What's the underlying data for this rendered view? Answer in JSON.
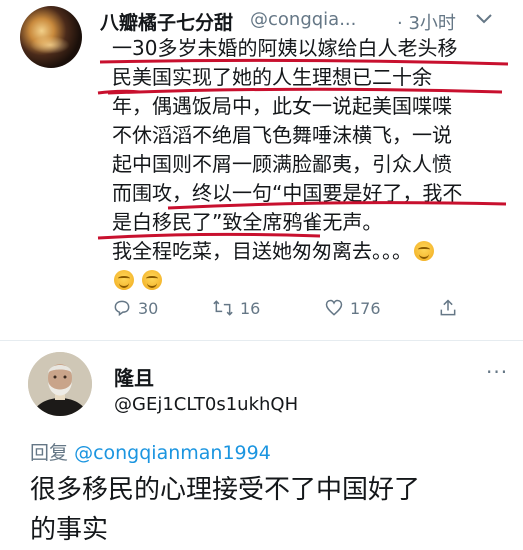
{
  "tweet": {
    "author_name": "八瓣橘子七分甜",
    "handle": "@congqia...",
    "time": "· 3小时",
    "lines": [
      "一30多岁未婚的阿姨以嫁给白人老头移",
      "民美国实现了她的人生理想已二十余",
      "年，偶遇饭局中，此女一说起美国喋喋",
      "不休滔滔不绝眉飞色舞唾沫横飞，一说",
      "起中国则不屑一顾满脸鄙夷，引众人愤",
      "而围攻，终以一句“中国要是好了，我不",
      "是白移民了”致全席鸦雀无声。",
      "我全程吃菜，目送她匆匆离去。。。"
    ],
    "actions": {
      "replies": "30",
      "retweets": "16",
      "likes": "176"
    }
  },
  "reply": {
    "author_name": "隆且",
    "handle": "@GEj1CLT0s1ukhQH",
    "reply_prefix": "回复",
    "reply_to": "@congqianman1994",
    "lines": [
      "很多移民的心理接受不了中国好了",
      "的事实"
    ]
  },
  "colors": {
    "secondary_text": "#657786",
    "link": "#1b95e0",
    "annotation_red": "#c8102e"
  },
  "icons": [
    "chevron-down-icon",
    "reply-icon",
    "retweet-icon",
    "like-icon",
    "share-icon",
    "more-icon",
    "smiling-emoji-icon",
    "relieved-emoji-icon"
  ]
}
